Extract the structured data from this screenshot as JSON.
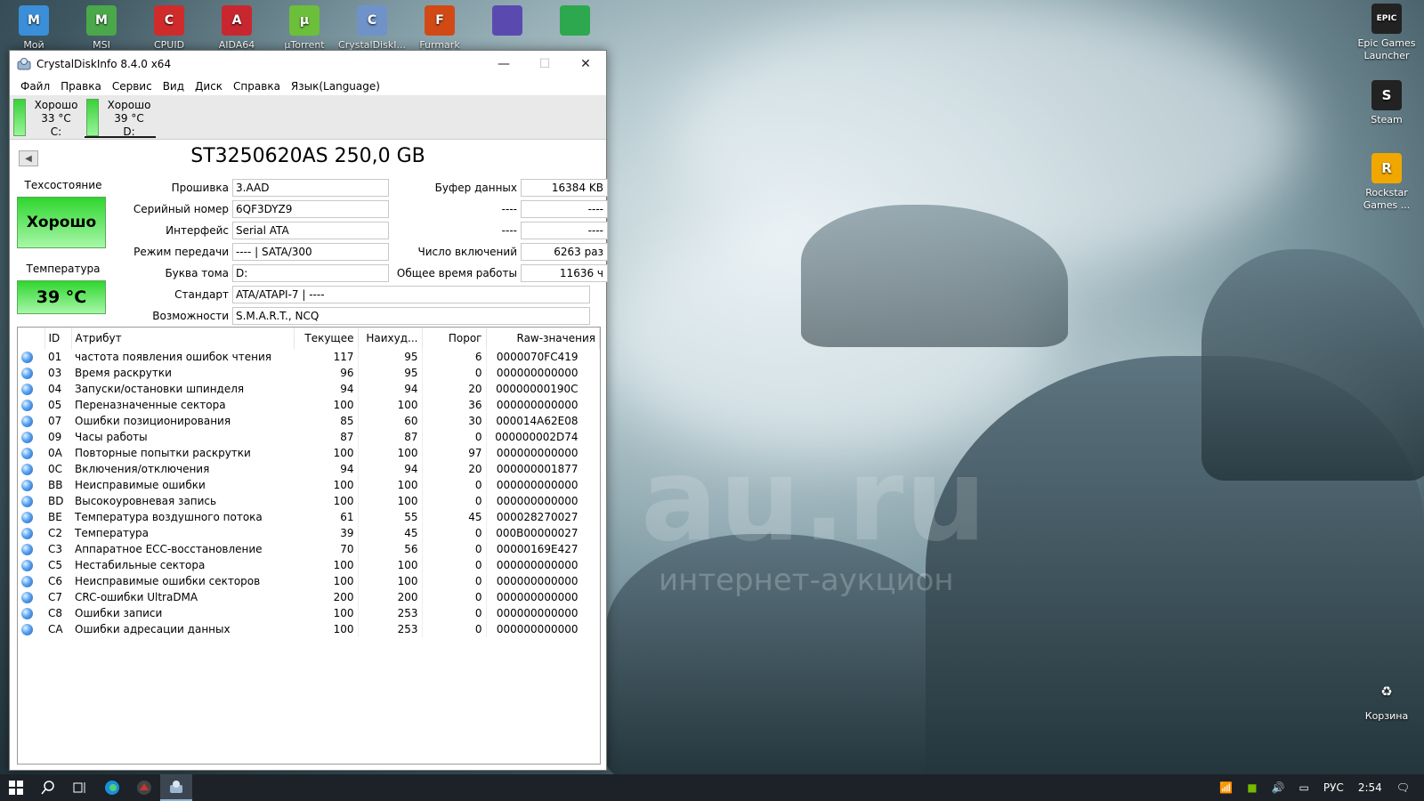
{
  "desktop": {
    "icons_left": [
      {
        "label": "Мой",
        "icon": "computer-icon",
        "color": "#3a8fd8"
      },
      {
        "label": "MSI",
        "icon": "msi-afterburner-icon",
        "color": "#4aa84a"
      },
      {
        "label": "CPUID",
        "icon": "cpuid-icon",
        "color": "#d02b2b"
      },
      {
        "label": "AIDA64",
        "icon": "aida64-icon",
        "color": "#c8272f"
      },
      {
        "label": "µTorrent",
        "icon": "utorrent-icon",
        "color": "#6cbf3a"
      },
      {
        "label": "CrystalDiskI...",
        "icon": "crystaldiskinfo-icon",
        "color": "#6f93c9"
      },
      {
        "label": "Furmark",
        "icon": "furmark-icon",
        "color": "#d14a16"
      },
      {
        "label": "",
        "icon": "cpu-z-icon",
        "color": "#5a4ab0"
      },
      {
        "label": "",
        "icon": "gpu-shark-icon",
        "color": "#2da84e"
      }
    ],
    "icons_right": [
      {
        "label": "Epic Games Launcher",
        "icon": "epic-games-icon",
        "text": "EPIC"
      },
      {
        "label": "Steam",
        "icon": "steam-icon",
        "text": "S"
      },
      {
        "label": "Rockstar Games ...",
        "icon": "rockstar-icon",
        "text": "R"
      },
      {
        "label": "Корзина",
        "icon": "recycle-bin-icon",
        "text": "♻"
      }
    ],
    "watermark_main": "au.ru",
    "watermark_sub": "интернет-аукцион"
  },
  "window": {
    "title": "CrystalDiskInfo 8.4.0 x64",
    "menu": [
      "Файл",
      "Правка",
      "Сервис",
      "Вид",
      "Диск",
      "Справка",
      "Язык(Language)"
    ],
    "drives": [
      {
        "state": "Хорошо",
        "temp": "33 °C",
        "letter": "C:"
      },
      {
        "state": "Хорошо",
        "temp": "39 °C",
        "letter": "D:"
      }
    ],
    "disk_title": "ST3250620AS 250,0 GB",
    "health_label": "Техсостояние",
    "health_value": "Хорошо",
    "temp_label": "Температура",
    "temp_value": "39 °C",
    "fields": {
      "firmware_label": "Прошивка",
      "firmware": "3.AAD",
      "serial_label": "Серийный номер",
      "serial": "6QF3DYZ9",
      "interface_label": "Интерфейс",
      "interface": "Serial ATA",
      "transfer_label": "Режим передачи",
      "transfer": "---- | SATA/300",
      "volume_label": "Буква тома",
      "volume": "D:",
      "standard_label": "Стандарт",
      "standard": "ATA/ATAPI-7 | ----",
      "features_label": "Возможности",
      "features": "S.M.A.R.T., NCQ",
      "buffer_label": "Буфер данных",
      "buffer": "16384 KB",
      "r2_label": "----",
      "r2": "----",
      "r3_label": "----",
      "r3": "----",
      "power_on_count_label": "Число включений",
      "power_on_count": "6263 раз",
      "power_on_hours_label": "Общее время работы",
      "power_on_hours": "11636 ч"
    },
    "table": {
      "headers": [
        "ID",
        "Атрибут",
        "Текущее",
        "Наихуд...",
        "Порог",
        "Raw-значения"
      ],
      "rows": [
        {
          "id": "01",
          "name": "частота появления ошибок чтения",
          "cur": "117",
          "worst": "95",
          "thr": "6",
          "raw": "0000070FC419"
        },
        {
          "id": "03",
          "name": "Время раскрутки",
          "cur": "96",
          "worst": "95",
          "thr": "0",
          "raw": "000000000000"
        },
        {
          "id": "04",
          "name": "Запуски/остановки шпинделя",
          "cur": "94",
          "worst": "94",
          "thr": "20",
          "raw": "00000000190C"
        },
        {
          "id": "05",
          "name": "Переназначенные сектора",
          "cur": "100",
          "worst": "100",
          "thr": "36",
          "raw": "000000000000"
        },
        {
          "id": "07",
          "name": "Ошибки позиционирования",
          "cur": "85",
          "worst": "60",
          "thr": "30",
          "raw": "000014A62E08"
        },
        {
          "id": "09",
          "name": "Часы работы",
          "cur": "87",
          "worst": "87",
          "thr": "0",
          "raw": "000000002D74"
        },
        {
          "id": "0A",
          "name": "Повторные попытки раскрутки",
          "cur": "100",
          "worst": "100",
          "thr": "97",
          "raw": "000000000000"
        },
        {
          "id": "0C",
          "name": "Включения/отключения",
          "cur": "94",
          "worst": "94",
          "thr": "20",
          "raw": "000000001877"
        },
        {
          "id": "BB",
          "name": "Неисправимые ошибки",
          "cur": "100",
          "worst": "100",
          "thr": "0",
          "raw": "000000000000"
        },
        {
          "id": "BD",
          "name": "Высокоуровневая запись",
          "cur": "100",
          "worst": "100",
          "thr": "0",
          "raw": "000000000000"
        },
        {
          "id": "BE",
          "name": "Температура воздушного потока",
          "cur": "61",
          "worst": "55",
          "thr": "45",
          "raw": "000028270027"
        },
        {
          "id": "C2",
          "name": "Температура",
          "cur": "39",
          "worst": "45",
          "thr": "0",
          "raw": "000B00000027"
        },
        {
          "id": "C3",
          "name": "Аппаратное ECC-восстановление",
          "cur": "70",
          "worst": "56",
          "thr": "0",
          "raw": "00000169E427"
        },
        {
          "id": "C5",
          "name": "Нестабильные сектора",
          "cur": "100",
          "worst": "100",
          "thr": "0",
          "raw": "000000000000"
        },
        {
          "id": "C6",
          "name": "Неисправимые ошибки секторов",
          "cur": "100",
          "worst": "100",
          "thr": "0",
          "raw": "000000000000"
        },
        {
          "id": "C7",
          "name": "CRC-ошибки UltraDMA",
          "cur": "200",
          "worst": "200",
          "thr": "0",
          "raw": "000000000000"
        },
        {
          "id": "C8",
          "name": "Ошибки записи",
          "cur": "100",
          "worst": "253",
          "thr": "0",
          "raw": "000000000000"
        },
        {
          "id": "CA",
          "name": "Ошибки адресации данных",
          "cur": "100",
          "worst": "253",
          "thr": "0",
          "raw": "000000000000"
        }
      ]
    }
  },
  "taskbar": {
    "apps": [
      "windows-start-icon",
      "search-icon",
      "task-view-icon",
      "edge-icon",
      "msi-afterburner-icon",
      "crystaldiskinfo-icon"
    ],
    "lang": "РУС",
    "time": "2:54"
  },
  "colors": {
    "good_green": "#2fd62f",
    "status_dot_blue": "#5aa3f0"
  }
}
